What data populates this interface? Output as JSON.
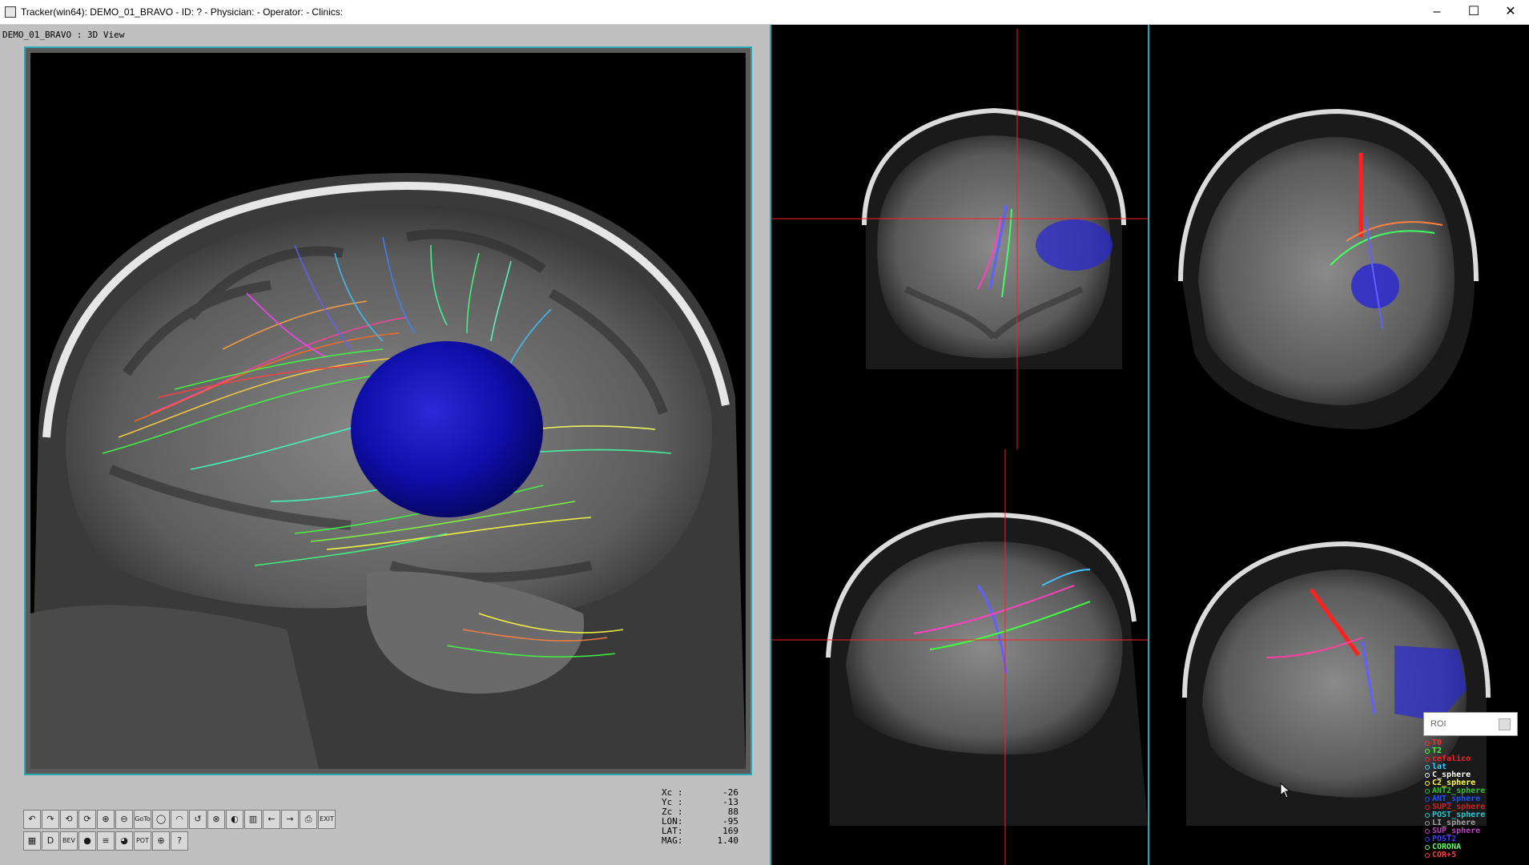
{
  "window": {
    "title": "Tracker(win64): DEMO_01_BRAVO - ID: ? - Physician: - Operator: - Clinics:",
    "minimize": "–",
    "maximize": "☐",
    "close": "✕"
  },
  "view3d": {
    "label": "DEMO_01_BRAVO : 3D View"
  },
  "toolbar": {
    "row1": [
      {
        "name": "undo-button",
        "glyph": "↶"
      },
      {
        "name": "redo-button",
        "glyph": "↷"
      },
      {
        "name": "rotate-left-button",
        "glyph": "⟲"
      },
      {
        "name": "rotate-right-button",
        "glyph": "⟳"
      },
      {
        "name": "zoom-in-button",
        "glyph": "⊕"
      },
      {
        "name": "zoom-out-button",
        "glyph": "⊖"
      },
      {
        "name": "goto-button",
        "glyph": "GoTo"
      },
      {
        "name": "sphere-button",
        "glyph": "◯"
      },
      {
        "name": "head-button",
        "glyph": "◠"
      },
      {
        "name": "reset-view-button",
        "glyph": "↺"
      },
      {
        "name": "clear-button",
        "glyph": "⊗"
      },
      {
        "name": "contrast-button",
        "glyph": "◐"
      },
      {
        "name": "panel-button",
        "glyph": "▥"
      },
      {
        "name": "arrow-left-button",
        "glyph": "←"
      },
      {
        "name": "arrow-right-button",
        "glyph": "→"
      },
      {
        "name": "print-button",
        "glyph": "⎙"
      },
      {
        "name": "exit-button",
        "glyph": "EXIT"
      }
    ],
    "row2": [
      {
        "name": "layout-button",
        "glyph": "▦"
      },
      {
        "name": "dicom-button",
        "glyph": "D"
      },
      {
        "name": "bev-button",
        "glyph": "BEV"
      },
      {
        "name": "record-button",
        "glyph": "●"
      },
      {
        "name": "fibers-button",
        "glyph": "≡"
      },
      {
        "name": "globe-button",
        "glyph": "◕"
      },
      {
        "name": "pot-button",
        "glyph": "POT"
      },
      {
        "name": "target-button",
        "glyph": "⊕"
      },
      {
        "name": "help-button",
        "glyph": "?"
      }
    ]
  },
  "coords": [
    {
      "label": "Xc :",
      "value": "-26"
    },
    {
      "label": "Yc :",
      "value": "-13"
    },
    {
      "label": "Zc :",
      "value": "88"
    },
    {
      "label": "LON:",
      "value": "-95"
    },
    {
      "label": "LAT:",
      "value": "169"
    },
    {
      "label": "MAG:",
      "value": "1.40"
    }
  ],
  "roi": {
    "placeholder": "ROI",
    "items": [
      {
        "label": "T0",
        "color": "#ff3030"
      },
      {
        "label": "T2",
        "color": "#40ff40"
      },
      {
        "label": "cefalico",
        "color": "#ff2020"
      },
      {
        "label": "lat",
        "color": "#40c8ff"
      },
      {
        "label": "C_sphere",
        "color": "#ffffff"
      },
      {
        "label": "C2_sphere",
        "color": "#ffff40"
      },
      {
        "label": "ANT2_sphere",
        "color": "#30c030"
      },
      {
        "label": "ANT_sphere",
        "color": "#2050ff"
      },
      {
        "label": "SUP2_sphere",
        "color": "#d02020"
      },
      {
        "label": "POST_sphere",
        "color": "#20c8d0"
      },
      {
        "label": "LI_sphere",
        "color": "#a0a0a0"
      },
      {
        "label": "SUP_sphere",
        "color": "#c040c0"
      },
      {
        "label": "POST2",
        "color": "#4040ff"
      },
      {
        "label": "CORONA",
        "color": "#60ff60"
      },
      {
        "label": "COR+5",
        "color": "#ff4040"
      }
    ]
  }
}
